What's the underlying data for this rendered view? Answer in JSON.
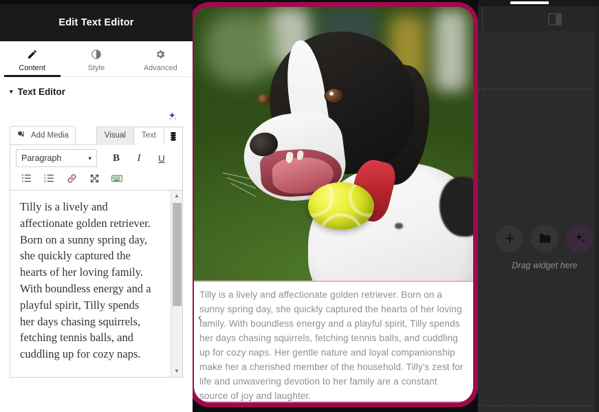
{
  "panel": {
    "title": "Edit Text Editor",
    "tabs": [
      {
        "label": "Content",
        "icon": "pencil-icon",
        "active": true
      },
      {
        "label": "Style",
        "icon": "contrast-icon",
        "active": false
      },
      {
        "label": "Advanced",
        "icon": "gear-icon",
        "active": false
      }
    ],
    "section": {
      "label": "Text Editor",
      "caret": "▾"
    },
    "ai_icon": "sparkle-icon",
    "editor": {
      "add_media_label": "Add Media",
      "add_media_icon": "media-icon",
      "mode_tabs": [
        {
          "label": "Visual",
          "selected": true
        },
        {
          "label": "Text",
          "selected": false
        }
      ],
      "mode_icon": "layers-icon",
      "format_select": {
        "value": "Paragraph",
        "caret": "▾"
      },
      "buttons_row1": [
        {
          "label": "B",
          "name": "bold-button"
        },
        {
          "label": "I",
          "name": "italic-button"
        },
        {
          "label": "U",
          "name": "underline-button"
        }
      ],
      "buttons_row2": [
        {
          "name": "bulleted-list-icon"
        },
        {
          "name": "numbered-list-icon"
        },
        {
          "name": "link-icon"
        },
        {
          "name": "fullscreen-icon"
        },
        {
          "name": "keyboard-icon"
        }
      ],
      "content_text": "Tilly is a lively and affectionate golden retriever. Born on a sunny spring day, she quickly captured the hearts of her loving family. With boundless energy and a playful spirit, Tilly spends her days chasing squirrels, fetching tennis balls, and cuddling up for cozy naps.",
      "scroll_up_arrow": "▲",
      "scroll_down_arrow": "▼"
    }
  },
  "canvas": {
    "widget_border_color": "#9e0b4c",
    "caption_border_color": "#f0a8d8",
    "image": {
      "alt": "black and white dog catching a yellow tennis ball on grass"
    },
    "caption_text": "Tilly is a lively and affectionate golden retriever. Born on a sunny spring day, she quickly captured the hearts of her loving family. With boundless energy and a playful spirit, Tilly spends her days chasing squirrels, fetching tennis balls, and cuddling up for cozy naps. Her gentle nature and loyal companionship make her a cherished member of the household. Tilly's zest for life and unwavering devotion to her family are a constant source of joy and laughter.",
    "prev_arrow": "‹"
  },
  "right_panel": {
    "book_icon": "book-icon",
    "dropzone": {
      "label": "Drag widget here",
      "buttons": [
        {
          "name": "add-element-button",
          "glyph": "+",
          "style": "plain"
        },
        {
          "name": "add-template-button",
          "glyph": "folder",
          "style": "plain"
        },
        {
          "name": "ai-generate-button",
          "glyph": "sparkle",
          "style": "ai"
        }
      ]
    }
  }
}
